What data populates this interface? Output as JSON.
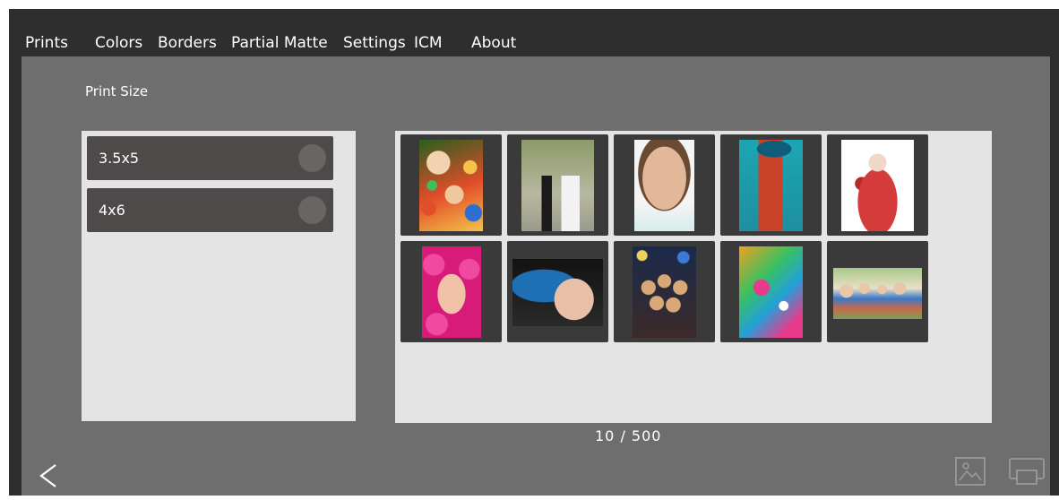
{
  "menu": {
    "items": [
      {
        "label": "Prints"
      },
      {
        "label": "Colors"
      },
      {
        "label": "Borders"
      },
      {
        "label": "Partial Matte"
      },
      {
        "label": "Settings"
      },
      {
        "label": "ICM"
      },
      {
        "label": "About"
      }
    ]
  },
  "print_size": {
    "label": "Print Size",
    "options": [
      {
        "label": "3.5x5",
        "selected": false
      },
      {
        "label": "4x6",
        "selected": false
      }
    ]
  },
  "gallery": {
    "thumbnails": [
      {
        "icon": "photo-two-boys-colorful-balls",
        "colors": [
          "#2a5e1f",
          "#e24d2a",
          "#f3c34a",
          "#2d6fd1"
        ]
      },
      {
        "icon": "photo-wedding-children",
        "colors": [
          "#9aa47f",
          "#1b1b1b",
          "#f2f2f2",
          "#6d7a52"
        ]
      },
      {
        "icon": "photo-woman-portrait",
        "colors": [
          "#f4f4f4",
          "#e3b898",
          "#6b4a33",
          "#c79a7c"
        ]
      },
      {
        "icon": "photo-redhead-blue-hat",
        "colors": [
          "#1ba6b3",
          "#0f5d7a",
          "#c8422a",
          "#1a1a1a"
        ]
      },
      {
        "icon": "photo-girl-red-dress",
        "colors": [
          "#ffffff",
          "#d43c3c",
          "#f0d8c8",
          "#b72a2a"
        ]
      },
      {
        "icon": "photo-woman-pink-flowers",
        "colors": [
          "#d81b78",
          "#f04aa0",
          "#f2c2a8",
          "#8a0f4a"
        ]
      },
      {
        "icon": "photo-woman-blue-hair",
        "colors": [
          "#121212",
          "#1f6fb5",
          "#d23b8c",
          "#e8c0a8"
        ]
      },
      {
        "icon": "photo-party-group",
        "colors": [
          "#1b2a4a",
          "#d8a878",
          "#3b7bd8",
          "#f0d05a"
        ]
      },
      {
        "icon": "photo-colorful-makeup",
        "colors": [
          "#f0a020",
          "#23a0d8",
          "#e83a8a",
          "#3ac060"
        ]
      },
      {
        "icon": "photo-family-outdoors",
        "colors": [
          "#7aa05a",
          "#e8e0c8",
          "#3c78c8",
          "#c86a4a"
        ]
      }
    ]
  },
  "pagination": {
    "text": "10  /  500"
  },
  "icons": {
    "back": "chevron-left-icon",
    "image": "image-icon",
    "printer": "printer-icon"
  }
}
